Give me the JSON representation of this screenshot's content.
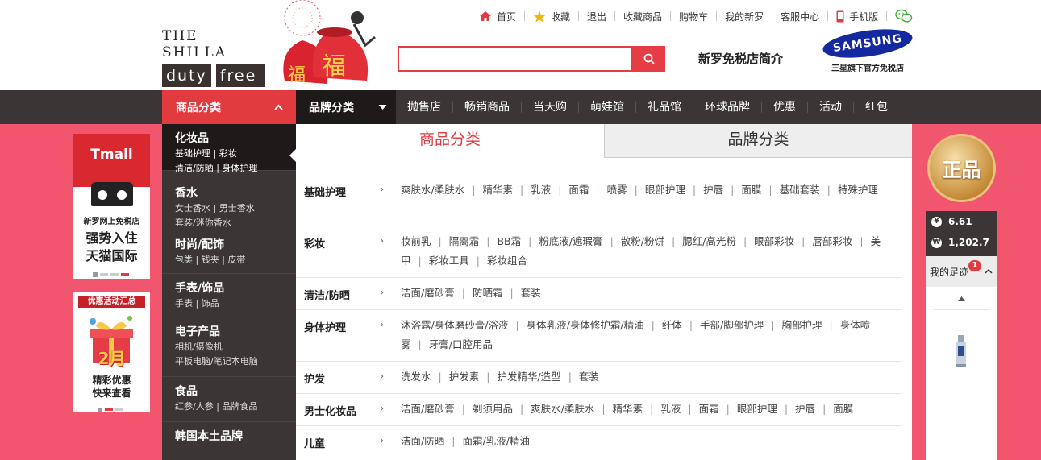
{
  "header": {
    "logo_line1": "THE SHILLA",
    "logo_word1": "duty",
    "logo_word2": "free",
    "top_links": [
      "首页",
      "收藏",
      "退出",
      "收藏商品",
      "购物车",
      "我的新罗",
      "客服中心",
      "手机版"
    ],
    "search_placeholder": "",
    "intro_link": "新罗免税店简介",
    "samsung_logo": "SAMSUNG",
    "samsung_caption": "三星旗下官方免税店",
    "colors": {
      "accent": "#e13b40",
      "dark": "#3b3535",
      "pink": "#f2566e"
    }
  },
  "nav": {
    "category_label": "商品分类",
    "brand_label": "品牌分类",
    "links": [
      "抛售店",
      "畅销商品",
      "当天购",
      "萌娃馆",
      "礼品馆",
      "环球品牌",
      "优惠",
      "活动",
      "红包"
    ]
  },
  "ads": {
    "tmall_title": "Tmall",
    "tmall_line1": "新罗网上免税店",
    "tmall_line2": "强势入住",
    "tmall_line3": "天猫国际",
    "promo_header": "优惠活动汇总",
    "promo_month": "2月",
    "promo_line1": "精彩优惠",
    "promo_line2": "快来查看"
  },
  "sidebar": [
    {
      "title": "化妆品",
      "subs": [
        "基础护理 | 彩妆",
        "清洁/防晒 | 身体护理"
      ],
      "active": true
    },
    {
      "title": "香水",
      "subs": [
        "女士香水 | 男士香水",
        "套装/迷你香水"
      ]
    },
    {
      "title": "时尚/配饰",
      "subs": [
        "包类 | 钱夹 | 皮带"
      ]
    },
    {
      "title": "手表/饰品",
      "subs": [
        "手表 | 饰品"
      ]
    },
    {
      "title": "电子产品",
      "subs": [
        "相机/摄像机",
        "平板电脑/笔记本电脑"
      ]
    },
    {
      "title": "食品",
      "subs": [
        "红参/人参 | 品牌食品"
      ]
    },
    {
      "title": "韩国本土品牌",
      "subs": []
    }
  ],
  "panel": {
    "tab_category": "商品分类",
    "tab_brand": "品牌分类",
    "rows": [
      {
        "label": "基础护理",
        "items": [
          "爽肤水/柔肤水",
          "精华素",
          "乳液",
          "面霜",
          "喷雾",
          "眼部护理",
          "护唇",
          "面膜",
          "基础套装",
          "特殊护理"
        ]
      },
      {
        "label": "彩妆",
        "items": [
          "妆前乳",
          "隔离霜",
          "BB霜",
          "粉底液/遮瑕膏",
          "散粉/粉饼",
          "腮红/高光粉",
          "眼部彩妆",
          "唇部彩妆",
          "美甲",
          "彩妆工具",
          "彩妆组合"
        ]
      },
      {
        "label": "清洁/防晒",
        "items": [
          "洁面/磨砂膏",
          "防晒霜",
          "套装"
        ]
      },
      {
        "label": "身体护理",
        "items": [
          "沐浴露/身体磨砂膏/浴液",
          "身体乳液/身体修护霜/精油",
          "纤体",
          "手部/脚部护理",
          "胸部护理",
          "身体喷雾",
          "牙膏/口腔用品"
        ]
      },
      {
        "label": "护发",
        "items": [
          "洗发水",
          "护发素",
          "护发精华/造型",
          "套装"
        ]
      },
      {
        "label": "男士化妆品",
        "items": [
          "洁面/磨砂膏",
          "剃须用品",
          "爽肤水/柔肤水",
          "精华素",
          "乳液",
          "面霜",
          "眼部护理",
          "护唇",
          "面膜"
        ]
      },
      {
        "label": "儿童",
        "items": [
          "洁面/防晒",
          "面霜/乳液/精油"
        ]
      }
    ]
  },
  "right": {
    "badge_text": "正品",
    "rate_cny": "6.61",
    "rate_krw": "1,202.7",
    "cny_symbol": "¥",
    "krw_symbol": "₩",
    "footprint_label": "我的足迹",
    "footprint_count": "1"
  }
}
